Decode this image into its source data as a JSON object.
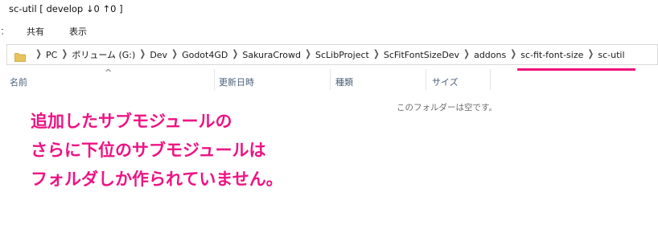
{
  "window": {
    "title": "sc-util [ develop ↓0 ↑0 ]"
  },
  "ribbon": {
    "collapsed_edge": "ァ",
    "tabs": [
      {
        "label": "共有"
      },
      {
        "label": "表示"
      }
    ]
  },
  "address_bar": {
    "folder_icon_color": "#e8c25a",
    "crumbs": [
      "PC",
      "ボリューム (G:)",
      "Dev",
      "Godot4GD",
      "SakuraCrowd",
      "ScLibProject",
      "ScFitFontSizeDev",
      "addons",
      "sc-fit-font-size",
      "sc-util"
    ]
  },
  "file_list": {
    "sort_indicator": "^",
    "columns": {
      "name": "名前",
      "date": "更新日時",
      "type": "種類",
      "size": "サイズ"
    },
    "empty_message": "このフォルダーは空です。"
  },
  "annotation": {
    "color": "#ee1383",
    "lines": [
      "追加したサブモジュールの",
      "さらに下位のサブモジュールは",
      "フォルダしか作られていません。"
    ]
  }
}
